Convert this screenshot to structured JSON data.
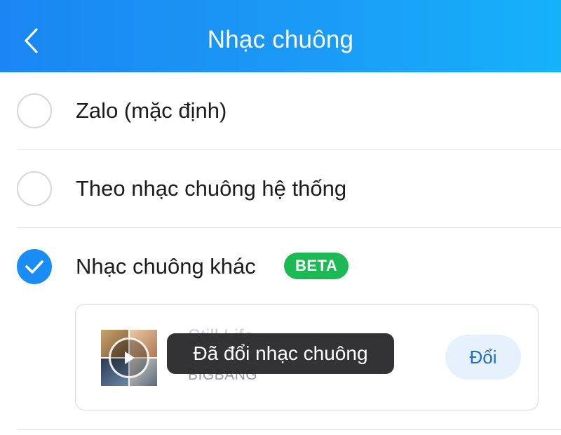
{
  "header": {
    "title": "Nhạc chuông",
    "back_icon": "chevron-left-icon"
  },
  "options": [
    {
      "label": "Zalo (mặc định)",
      "selected": false
    },
    {
      "label": "Theo nhạc chuông hệ thống",
      "selected": false
    },
    {
      "label": "Nhạc chuông khác",
      "selected": true,
      "badge": "BETA"
    }
  ],
  "song": {
    "title": "Still Life",
    "artist": "BIGBANG",
    "change_label": "Đổi",
    "play_icon": "play-icon"
  },
  "toast": {
    "message": "Đã đổi nhạc chuông"
  },
  "colors": {
    "header": "#1a8cf5",
    "accent": "#1a8cf5",
    "badge": "#1db954"
  }
}
